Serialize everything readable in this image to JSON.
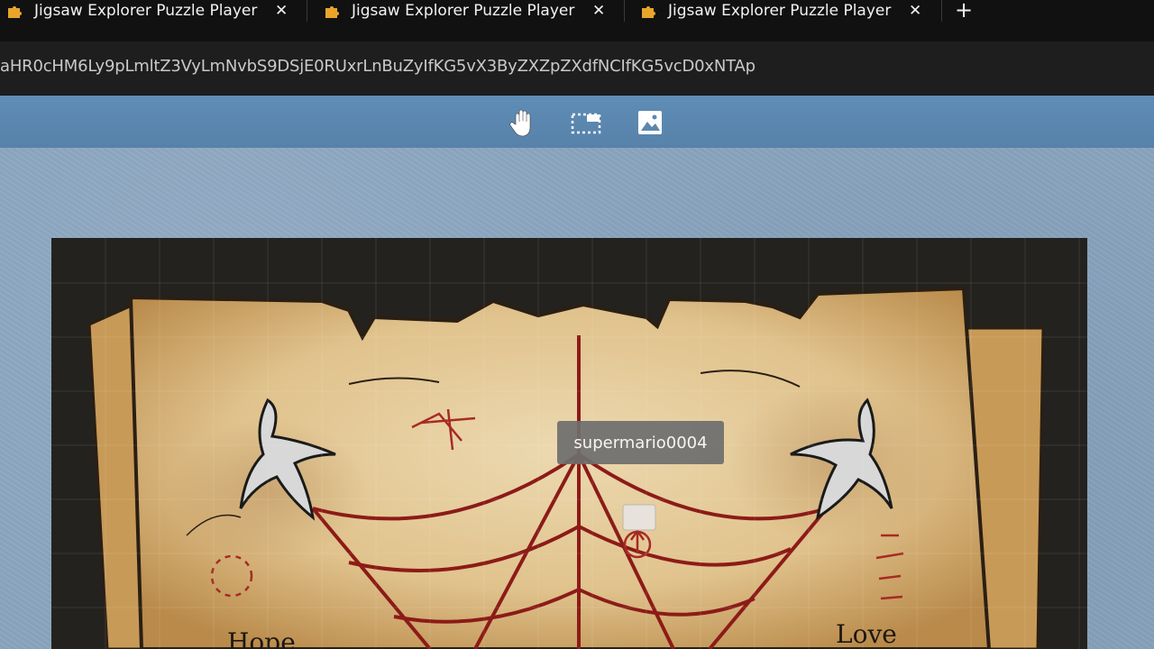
{
  "browser": {
    "tabs": [
      {
        "title": "Jigsaw Explorer Puzzle Player",
        "close": "✕"
      },
      {
        "title": "Jigsaw Explorer Puzzle Player",
        "close": "✕"
      },
      {
        "title": "Jigsaw Explorer Puzzle Player",
        "close": "✕"
      }
    ],
    "new_tab": "+",
    "address": "aHR0cHM6Ly9pLmltZ3VyLmNvbS9DSjE0RUxrLnBuZyIfKG5vX3ByZXZpZXdfNCIfKG5vcD0xNTAp"
  },
  "toolbar": {
    "icons": [
      "hand-icon",
      "selection-icon",
      "image-icon"
    ]
  },
  "puzzle": {
    "player_label": "supermario0004",
    "page_words": [
      "Hope",
      "Love"
    ]
  },
  "colors": {
    "toolbar": "#5b87af",
    "board": "#8aa5bf",
    "parchment": "#e6cfa0",
    "web_lines": "#8c1b18"
  }
}
